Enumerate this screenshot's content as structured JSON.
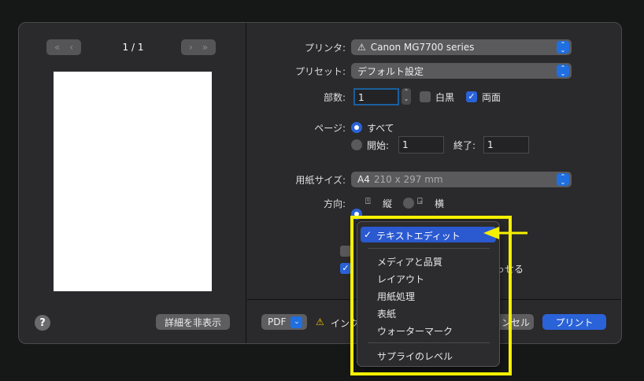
{
  "preview": {
    "page_indicator": "1 / 1",
    "first": "«",
    "prev": "‹",
    "next": "›",
    "last": "»"
  },
  "left_footer": {
    "help": "?",
    "hide_details": "詳細を非表示"
  },
  "form": {
    "printer_label": "プリンタ:",
    "printer_value": "Canon MG7700 series",
    "preset_label": "プリセット:",
    "preset_value": "デフォルト設定",
    "copies_label": "部数:",
    "copies_value": "1",
    "bw_label": "白黒",
    "bw_checked": false,
    "duplex_label": "両面",
    "duplex_checked": true,
    "pages_label": "ページ:",
    "pages_all": "すべて",
    "pages_from_label": "開始:",
    "pages_from": "1",
    "pages_to_label": "終了:",
    "pages_to": "1",
    "paper_label": "用紙サイズ:",
    "paper_value": "A4",
    "paper_dims": "210 x 297 mm",
    "orientation_label": "方向:",
    "portrait": "縦",
    "landscape": "横",
    "hidden_option_suffix": "っせる"
  },
  "footer": {
    "pdf": "PDF",
    "warning": "インク",
    "cancel": "キャンセル",
    "print": "プリント"
  },
  "menu": {
    "selected": "テキストエディット",
    "items": [
      "メディアと品質",
      "レイアウト",
      "用紙処理",
      "表紙",
      "ウォーターマーク"
    ],
    "last": "サプライのレベル"
  },
  "colors": {
    "accent": "#2a62d8",
    "highlight": "#f5f000"
  }
}
